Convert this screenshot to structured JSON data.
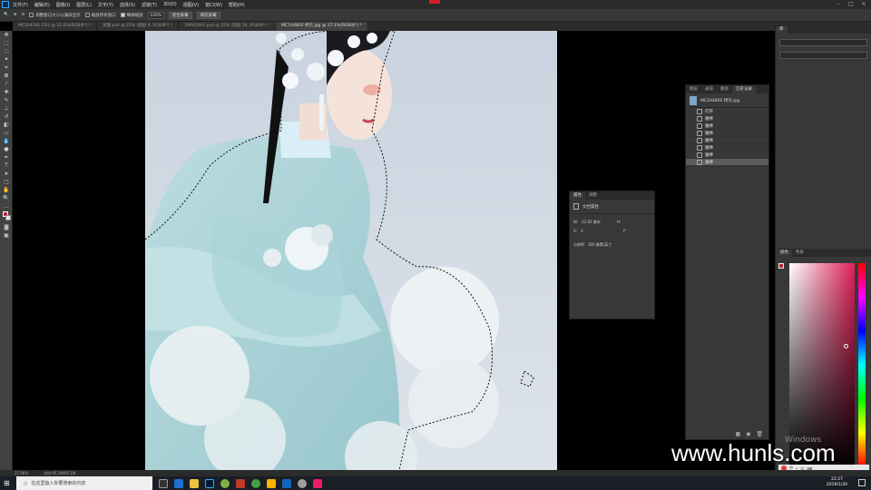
{
  "menubar": {
    "items": [
      "文件(F)",
      "编辑(E)",
      "图像(I)",
      "图层(L)",
      "文字(Y)",
      "选择(S)",
      "滤镜(T)",
      "3D(D)",
      "视图(V)",
      "窗口(W)",
      "帮助(H)"
    ]
  },
  "options": {
    "resize_windows": "调整窗口大小以满屏显示",
    "zoom_all": "缩放所有窗口",
    "scrubby_zoom": "细微缩放",
    "zoom_value": "100%",
    "fit_screen": "适合屏幕",
    "fill_screen": "填充屏幕"
  },
  "tabs": [
    {
      "label": "MC1A4161.CR2 @ 22.6%(RGB/8*) *"
    },
    {
      "label": "试图.psd @ 25% (图层 0, RGB/8*) *"
    },
    {
      "label": "19RA2001.psd @ 25% (图层 16, RGB/8*) *"
    },
    {
      "label": "MC1A4802 拷贝.jpg @ 27.1%(RGB/8*) *"
    }
  ],
  "history": {
    "tabs": [
      "图层",
      "通道",
      "路径",
      "历史记录"
    ],
    "snapshot": "MC1A4802 拷贝.jpg",
    "items": [
      "打开",
      "魔棒",
      "魔棒",
      "魔棒",
      "魔棒",
      "魔棒",
      "魔棒",
      "魔棒"
    ]
  },
  "properties": {
    "tabs": [
      "属性",
      "调整"
    ],
    "section": "文档属性",
    "w_label": "W:",
    "w_value": "22.83 厘米",
    "h_label": "H:",
    "h_value": "",
    "x_label": "X:",
    "x_value": "0",
    "y_label": "Y:",
    "resolution": "分辨率：300 像素/英寸"
  },
  "top_panel": {
    "tabs": [
      "库"
    ]
  },
  "color_panel": {
    "tabs": [
      "颜色",
      "色板"
    ],
    "hue_marker": "#d83060"
  },
  "status": {
    "zoom": "27.08%",
    "doc": "文档:95.1M/95.1M"
  },
  "taskbar": {
    "search_placeholder": "在这里输入你要搜索的内容",
    "time": "22:27",
    "date": "2019/1/30"
  },
  "watermark": "www.hunls.com",
  "windows_activation": "Windows"
}
